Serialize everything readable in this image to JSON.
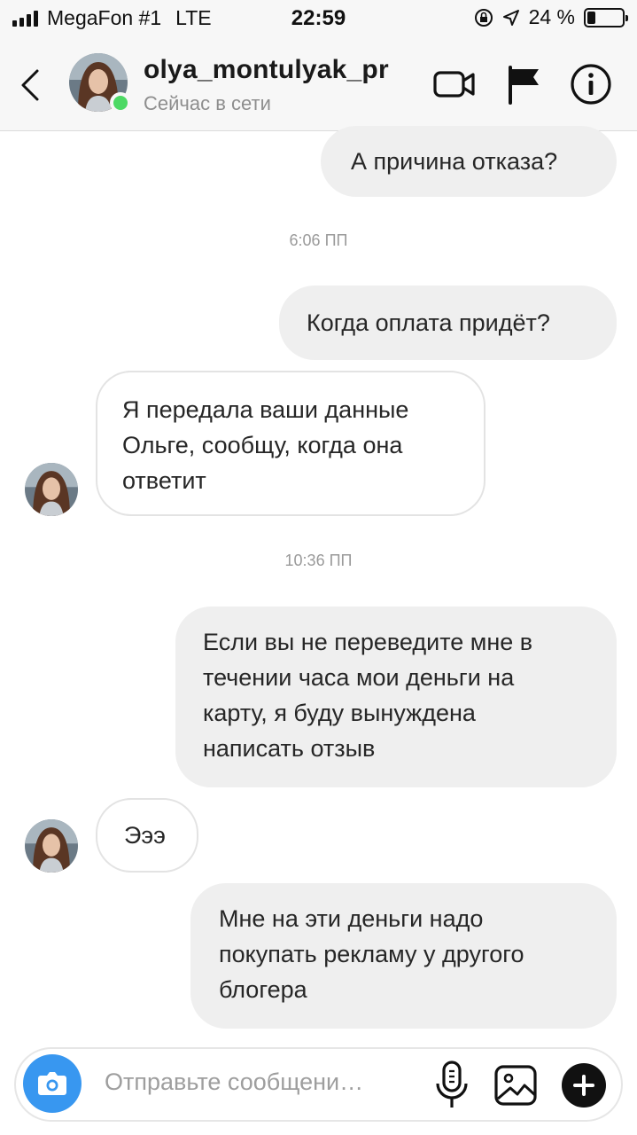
{
  "status_bar": {
    "carrier": "MegaFon #1",
    "network": "LTE",
    "time": "22:59",
    "battery_text": "24 %",
    "battery_level": 0.24
  },
  "header": {
    "username": "olya_montulyak_pr",
    "presence": "Сейчас в сети",
    "icons": [
      "back-chevron-icon",
      "video-call-icon",
      "flag-icon",
      "info-icon"
    ]
  },
  "thread": {
    "m1": "А причина отказа?",
    "t1": "6:06 ПП",
    "m2": "Когда оплата придёт?",
    "m3": [
      "Я передала ваши данные",
      "Ольге, сообщу, когда она",
      "ответит"
    ],
    "t2": "10:36 ПП",
    "m4": [
      "Если вы не переведите мне в",
      "течении часа мои деньги на",
      "карту, я буду вынуждена",
      "написать отзыв"
    ],
    "m5": "Эээ",
    "m6": [
      "Мне на эти деньги надо",
      "покупать рекламу у другого",
      "блогера"
    ]
  },
  "composer": {
    "placeholder": "Отправьте сообщени…",
    "accent": "#3897f0"
  },
  "colors": {
    "outgoing_bubble": "#efefef",
    "incoming_border": "#e3e3e3",
    "online": "#4cd964"
  }
}
